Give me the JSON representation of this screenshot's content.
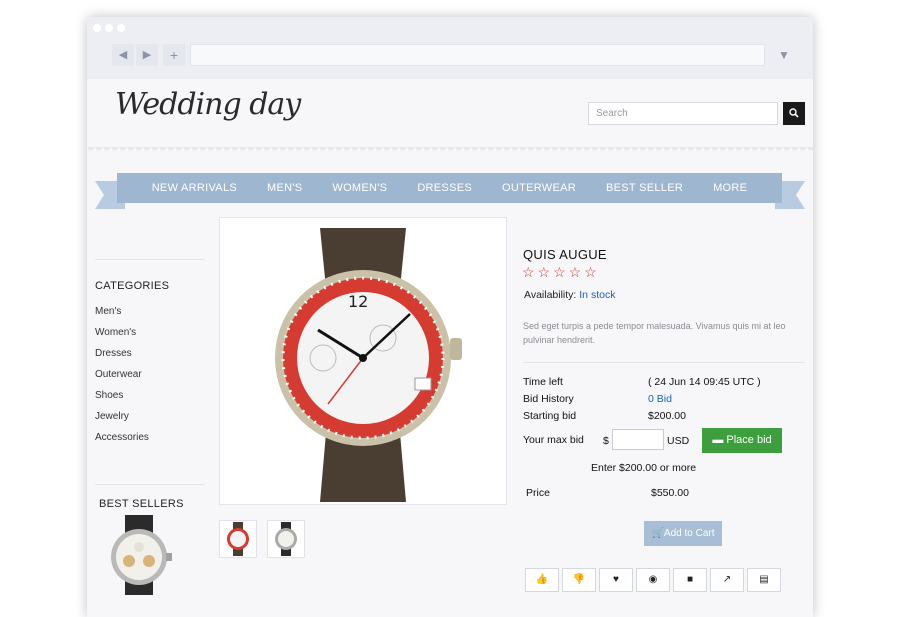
{
  "browser": {
    "back_icon": "back-icon",
    "forward_icon": "forward-icon",
    "new_tab_icon": "plus-icon",
    "menu_icon": "chevron-down-icon"
  },
  "header": {
    "logo_text": "Wedding day",
    "search_placeholder": "Search",
    "search_icon": "search-icon"
  },
  "nav": {
    "items": [
      "NEW ARRIVALS",
      "MEN'S",
      "WOMEN'S",
      "DRESSES",
      "OUTERWEAR",
      "BEST SELLER",
      "MORE"
    ]
  },
  "sidebar": {
    "categories_title": "CATEGORIES",
    "categories": [
      "Men's",
      "Women's",
      "Dresses",
      "Outerwear",
      "Shoes",
      "Jewelry",
      "Accessories"
    ],
    "best_sellers_title": "BEST SELLERS"
  },
  "product": {
    "title": "QUIS AUGUE",
    "stars": "☆☆☆☆☆",
    "availability_label": "Availability:",
    "availability_value": "In stock",
    "description": "Sed eget turpis a pede tempor malesuada. Vivamus quis mi at leo pulvinar hendrerit.",
    "time_left_label": "Time left",
    "time_left_value": "( 24 Jun 14 09:45 UTC )",
    "bid_history_label": "Bid History",
    "bid_history_value": "0 Bid",
    "starting_bid_label": "Starting bid",
    "starting_bid_value": "$200.00",
    "max_bid_label": "Your max bid",
    "currency_symbol": "$",
    "currency_code": "USD",
    "place_bid_label": "Place bid",
    "min_bid_hint": "Enter $200.00 or more",
    "price_label": "Price",
    "price_value": "$550.00",
    "add_to_cart_label": "Add to Cart"
  },
  "actions": [
    "like-icon",
    "dislike-icon",
    "heart-icon",
    "eye-icon",
    "gift-icon",
    "share-icon",
    "print-icon"
  ],
  "colors": {
    "nav": "#9fb6d1",
    "place_bid": "#3d9e3d",
    "add_to_cart": "#a8bed6",
    "stars": "#c0392b",
    "link": "#1a5fb4"
  }
}
